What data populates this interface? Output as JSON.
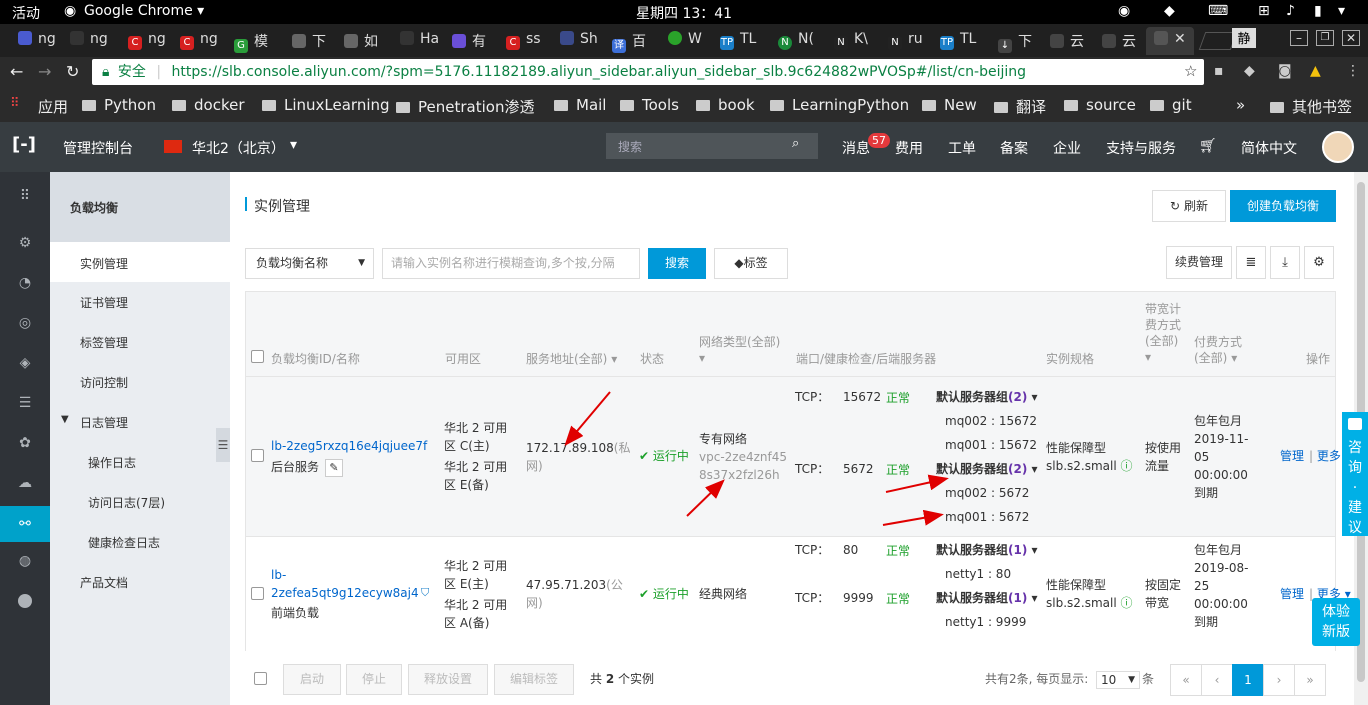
{
  "gnome": {
    "activities": "活动",
    "app": "Google Chrome ▾",
    "clock": "星期四 13：41",
    "ime": "静"
  },
  "tabs": [
    {
      "label": "ng"
    },
    {
      "label": "ng"
    },
    {
      "label": "ng"
    },
    {
      "label": "ng"
    },
    {
      "label": "模"
    },
    {
      "label": "下"
    },
    {
      "label": "如"
    },
    {
      "label": "Ha"
    },
    {
      "label": "有"
    },
    {
      "label": "ss"
    },
    {
      "label": "Sh"
    },
    {
      "label": "百"
    },
    {
      "label": "W"
    },
    {
      "label": "TL"
    },
    {
      "label": "N("
    },
    {
      "label": "K\\"
    },
    {
      "label": "ru"
    },
    {
      "label": "TL"
    },
    {
      "label": "下"
    },
    {
      "label": "云"
    },
    {
      "label": "云"
    },
    {
      "label": ""
    }
  ],
  "address": {
    "secure": "安全",
    "url": "https://slb.console.aliyun.com/?spm=5176.11182189.aliyun_sidebar.aliyun_sidebar_slb.9c624882wPVOSp#/list/cn-beijing"
  },
  "bookmarks": {
    "apps": "应用",
    "items": [
      "Python",
      "docker",
      "LinuxLearning",
      "Penetration渗透",
      "Mail",
      "Tools",
      "book",
      "LearningPython",
      "New",
      "翻译",
      "source",
      "git"
    ],
    "more": "»",
    "other": "其他书签"
  },
  "console_header": {
    "home": "管理控制台",
    "region": "华北2（北京）",
    "search_placeholder": "搜索",
    "messages": "消息",
    "msg_count": "57",
    "nav": [
      "费用",
      "工单",
      "备案",
      "企业",
      "支持与服务"
    ],
    "lang": "简体中文"
  },
  "sidebar": {
    "title": "负载均衡",
    "items": [
      "实例管理",
      "证书管理",
      "标签管理",
      "访问控制",
      "日志管理",
      "操作日志",
      "访问日志(7层)",
      "健康检查日志",
      "产品文档"
    ]
  },
  "page": {
    "title": "实例管理",
    "refresh": "刷新",
    "create": "创建负载均衡"
  },
  "filter": {
    "select": "负载均衡名称",
    "placeholder": "请输入实例名称进行模糊查询,多个按,分隔",
    "search": "搜索",
    "tag": "标签",
    "renew": "续费管理"
  },
  "columns": {
    "id": "负载均衡ID/名称",
    "zone": "可用区",
    "addr": "服务地址(全部)",
    "status": "状态",
    "net": "网络类型(全部)",
    "ports": "端口/健康检查/后端服务器",
    "spec": "实例规格",
    "bw1": "带宽计",
    "bw2": "费方式",
    "bw3": "(全部)",
    "pay1": "付费方式",
    "pay2": "(全部)",
    "op": "操作"
  },
  "rows": [
    {
      "id": "lb-2zeg5rxzq16e4jqjuee7f",
      "name": "后台服务",
      "zone1": "华北 2 可用",
      "zone1b": "区 C(主)",
      "zone2": "华北 2 可用",
      "zone2b": "区 E(备)",
      "ip": "172.17.89.108",
      "iptype": "(私",
      "iptype2": "网)",
      "status": "运行中",
      "net": "专有网络",
      "vpc1": "vpc-2ze4znf45",
      "vpc2": "8s37x2fzl26h",
      "l1proto": "TCP：",
      "l1port": "15672",
      "l1health": "正常",
      "l1group": "默认服务器组",
      "l1count": "(2)",
      "l1s1": "mq002 : 15672",
      "l1s2": "mq001 : 15672",
      "l2proto": "TCP：",
      "l2port": "5672",
      "l2health": "正常",
      "l2group": "默认服务器组",
      "l2count": "(2)",
      "l2s1": "mq002 : 5672",
      "l2s2": "mq001 : 5672",
      "spec1": "性能保障型",
      "spec2": "slb.s2.small",
      "bw1": "按使用",
      "bw2": "流量",
      "pay1": "包年包月",
      "pay2": "2019-11-",
      "pay3": "05",
      "pay4": "00:00:00",
      "pay5": "到期",
      "manage": "管理",
      "more": "更多"
    },
    {
      "id1": "lb-",
      "id2": "2zefea5qt9g12ecyw8aj4",
      "name": "前端负载",
      "zone1": "华北 2 可用",
      "zone1b": "区 E(主)",
      "zone2": "华北 2 可用",
      "zone2b": "区 A(备)",
      "ip": "47.95.71.203",
      "iptype": "(公",
      "iptype2": "网)",
      "status": "运行中",
      "net": "经典网络",
      "l1proto": "TCP：",
      "l1port": "80",
      "l1health": "正常",
      "l1group": "默认服务器组",
      "l1count": "(1)",
      "l1s1": "netty1 : 80",
      "l2proto": "TCP：",
      "l2port": "9999",
      "l2health": "正常",
      "l2group": "默认服务器组",
      "l2count": "(1)",
      "l2s1": "netty1 : 9999",
      "spec1": "性能保障型",
      "spec2": "slb.s2.small",
      "bw1": "按固定",
      "bw2": "带宽",
      "pay1": "包年包月",
      "pay2": "2019-08-",
      "pay3": "25",
      "pay4": "00:00:00",
      "pay5": "到期",
      "manage": "管理",
      "more": "更多"
    }
  ],
  "footer": {
    "start": "启动",
    "stop": "停止",
    "release": "释放设置",
    "edit_tag": "编辑标签",
    "total_pre": "共",
    "total_num": "2",
    "total_post": "个实例",
    "paging": "共有2条, 每页显示:",
    "page_size": "10",
    "unit": "条",
    "first": "«",
    "prev": "‹",
    "page": "1",
    "next": "›",
    "last": "»"
  },
  "float": {
    "advice": [
      "咨",
      "询",
      "·",
      "建",
      "议"
    ],
    "trial1": "体验",
    "trial2": "新版"
  },
  "colors": {
    "accent": "#0099d9",
    "header": "#373d41",
    "sidebar": "#eaedf1",
    "iconbar": "#2f3338",
    "annotation": "#e00000"
  }
}
